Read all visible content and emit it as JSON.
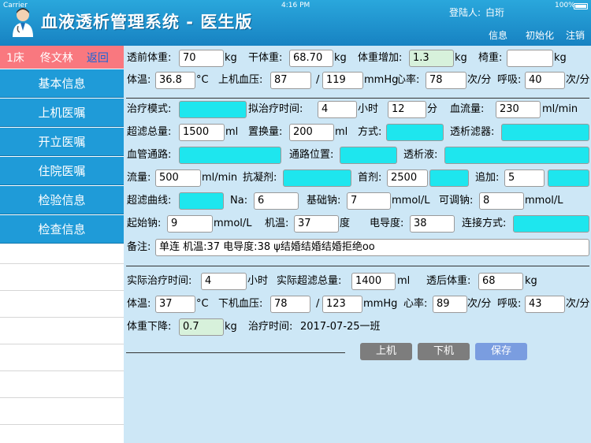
{
  "status": {
    "carrier": "Carrier",
    "time": "4:16 PM",
    "battery": "100%"
  },
  "header": {
    "title": "血液透析管理系统 - 医生版",
    "login_label": "登陆人:",
    "login_user": "白珩",
    "buttons": [
      "信息",
      "初始化",
      "注销"
    ]
  },
  "sidebar": {
    "bed": "1床",
    "patient": "佟文林",
    "back": "返回",
    "items": [
      "基本信息",
      "上机医嘱",
      "开立医嘱",
      "住院医嘱",
      "检验信息",
      "检查信息"
    ]
  },
  "form": {
    "pre_weight_label": "透前体重:",
    "pre_weight": "70",
    "kg1": "kg",
    "dry_weight_label": "干体重:",
    "dry_weight": "68.70",
    "kg2": "kg",
    "gain_label": "体重增加:",
    "gain": "1.3",
    "kg3": "kg",
    "chair_label": "椅重:",
    "chair": "",
    "kg4": "kg",
    "temp_label": "体温:",
    "temp": "36.8",
    "c1": "°C",
    "bp_on_label": "上机血压:",
    "bp_on_sys": "87",
    "slash1": "/",
    "bp_on_dia": "119",
    "mmhg1": "mmHg",
    "hr_label": "心率:",
    "hr": "78",
    "bpm1": "次/分",
    "resp_label": "呼吸:",
    "resp": "40",
    "bpm2": "次/分",
    "mode_label": "治疗模式:",
    "mode": "",
    "plan_time_label": "拟治疗时间:",
    "plan_hours": "4",
    "hour_unit": "小时",
    "plan_min": "12",
    "min_unit": "分",
    "flow_label": "血流量:",
    "flow": "230",
    "flow_unit": "ml/min",
    "uf_total_label": "超滤总量:",
    "uf_total": "1500",
    "ml1": "ml",
    "replace_label": "置换量:",
    "replace": "200",
    "ml2": "ml",
    "method_label": "方式:",
    "method": "",
    "dialyzer_label": "透析滤器:",
    "dialyzer": "",
    "access_label": "血管通路:",
    "access": "",
    "access_pos_label": "通路位置:",
    "access_pos": "",
    "dialysate_label": "透析液:",
    "dialysate": "",
    "flow2_label": "流量:",
    "flow2": "500",
    "flow2_unit": "ml/min",
    "anticoag_label": "抗凝剂:",
    "anticoag": "",
    "first_dose_label": "首剂:",
    "first_dose": "2500",
    "first_dose_unit": "",
    "add_label": "追加:",
    "add": "5",
    "add_unit": "",
    "uf_curve_label": "超滤曲线:",
    "uf_curve": "",
    "na_label": "Na:",
    "na": "6",
    "base_na_label": "基础钠:",
    "base_na": "7",
    "mmol1": "mmol/L",
    "adj_na_label": "可调钠:",
    "adj_na": "8",
    "mmol2": "mmol/L",
    "start_na_label": "起始钠:",
    "start_na": "9",
    "mmol3": "mmol/L",
    "machine_temp_label": "机温:",
    "machine_temp": "37",
    "deg": "度",
    "conduct_label": "电导度:",
    "conduct": "38",
    "connect_label": "连接方式:",
    "connect": "",
    "note_label": "备注:",
    "note": "单连 机温:37 电导度:38 ψ结婚结婚结婚拒绝oo",
    "actual_time_label": "实际治疗时间:",
    "actual_time": "4",
    "hour_unit2": "小时",
    "actual_uf_label": "实际超滤总量:",
    "actual_uf": "1400",
    "ml3": "ml",
    "post_weight_label": "透后体重:",
    "post_weight": "68",
    "kg5": "kg",
    "temp2_label": "体温:",
    "temp2": "37",
    "c2": "°C",
    "bp_off_label": "下机血压:",
    "bp_off_sys": "78",
    "slash2": "/",
    "bp_off_dia": "123",
    "mmhg2": "mmHg",
    "hr2_label": "心率:",
    "hr2": "89",
    "bpm3": "次/分",
    "resp2_label": "呼吸:",
    "resp2": "43",
    "bpm4": "次/分",
    "drop_label": "体重下降:",
    "drop": "0.7",
    "kg6": "kg",
    "treat_time_label": "治疗时间:",
    "treat_time": "2017-07-25一班"
  },
  "actions": {
    "on": "上机",
    "off": "下机",
    "save": "保存"
  }
}
